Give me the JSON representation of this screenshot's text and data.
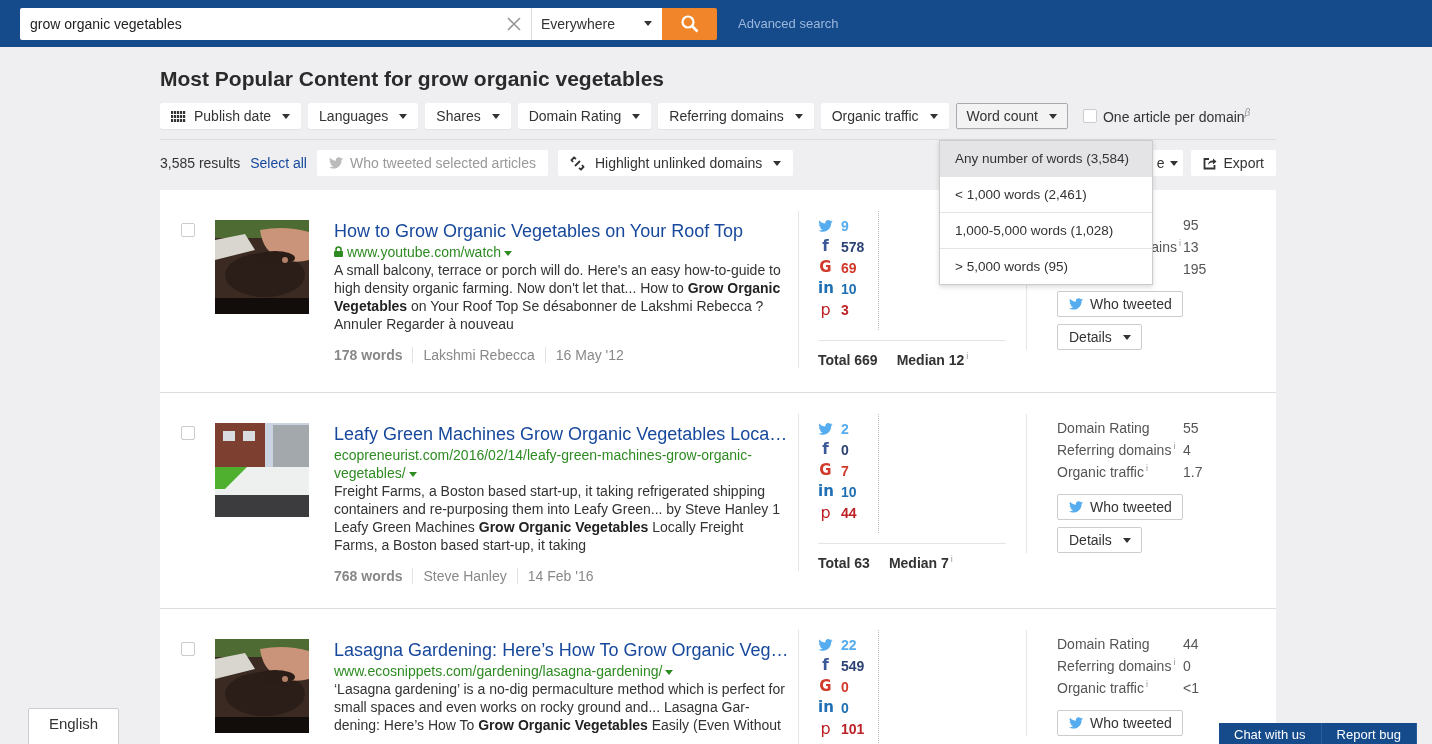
{
  "search": {
    "query": "grow organic vegetables",
    "scope": "Everywhere",
    "advanced": "Advanced search"
  },
  "heading": "Most Popular Content for grow organic vegetables",
  "filters": [
    {
      "label": "Publish date",
      "icon": true,
      "open": false
    },
    {
      "label": "Languages",
      "icon": false,
      "open": false
    },
    {
      "label": "Shares",
      "icon": false,
      "open": false
    },
    {
      "label": "Domain Rating",
      "icon": false,
      "open": false
    },
    {
      "label": "Referring domains",
      "icon": false,
      "open": false
    },
    {
      "label": "Organic traffic",
      "icon": false,
      "open": false
    },
    {
      "label": "Word count",
      "icon": false,
      "open": true
    }
  ],
  "one_per_domain": {
    "label": "One article per domain$^{β}$",
    "checked": false
  },
  "toolbar": {
    "results": "3,585 results",
    "select_all": "Select all",
    "who_tweeted": {
      "label": "Who tweeted selected articles",
      "disabled": true
    },
    "highlight": "Highlight unlinked domains",
    "sort": "e",
    "export": "Export"
  },
  "word_count_menu": [
    {
      "label": "Any number of words (3,584)",
      "selected": true
    },
    {
      "label": "< 1,000 words (2,461)",
      "selected": false
    },
    {
      "label": "1,000-5,000 words (1,028)",
      "selected": false
    },
    {
      "label": "> 5,000 words (95)",
      "selected": false
    }
  ],
  "articles": [
    {
      "checked": false,
      "title": "How to Grow Organic Vegetables on Your Roof Top",
      "secure": true,
      "url": "www.youtube.com/watch",
      "snippet": "A small balcony, terrace or porch will do. Here's an easy how-to-guide to high density organic farming. Now don't let that... How to **Grow Organic Vegetables** on Your Roof Top Se désabonner de Lakshmi Rebecca ? Annuler Regarder à nouveau",
      "words": "178 words",
      "author": "Lakshmi Rebecca",
      "date": "16 May '12",
      "shares": [
        {
          "kind": "twitter",
          "value": "9"
        },
        {
          "kind": "facebook",
          "icon": "f",
          "value": "578"
        },
        {
          "kind": "google",
          "icon": "G",
          "value": "69"
        },
        {
          "kind": "linkedin",
          "icon": "in",
          "value": "10"
        },
        {
          "kind": "pinterest",
          "icon": "p",
          "value": "3"
        }
      ],
      "total": "Total 669",
      "median": "Median 12",
      "median_info": "i",
      "metrics": [
        {
          "value": "95"
        },
        {
          "label": "ains",
          "info": "i",
          "clipped": true,
          "value": "13"
        },
        {
          "value": "195"
        }
      ],
      "buttons": [
        {
          "kind": "tweet",
          "label": "Who tweeted"
        },
        {
          "kind": "details",
          "label": "Details"
        }
      ]
    },
    {
      "checked": false,
      "title": "Leafy Green Machines Grow Organic Vegetables Loca…",
      "secure": false,
      "url": "ecopreneurist.com/2016/02/14/leafy-green-machines-grow-organic-vegetables/",
      "snippet": "Freight Farms, a Boston based start-up, it taking refrigerated shipping containers and re-purposing them into Leafy Green... by Steve Hanley 1 Leafy Green Machines **Grow Organic Vegetables** Locally Freight Farms, a Boston based start-up, it taking",
      "words": "768 words",
      "author": "Steve Hanley",
      "date": "14 Feb '16",
      "shares": [
        {
          "kind": "twitter",
          "value": "2"
        },
        {
          "kind": "facebook",
          "icon": "f",
          "value": "0"
        },
        {
          "kind": "google",
          "icon": "G",
          "value": "7"
        },
        {
          "kind": "linkedin",
          "icon": "in",
          "value": "10"
        },
        {
          "kind": "pinterest",
          "icon": "p",
          "value": "44"
        }
      ],
      "total": "Total 63",
      "median": "Median 7",
      "median_info": "i",
      "metrics": [
        {
          "label": "Domain Rating",
          "value": "55"
        },
        {
          "label": "Referring domains",
          "info": "i",
          "value": "4"
        },
        {
          "label": "Organic traffic",
          "info": "i",
          "value": "1.7"
        }
      ],
      "buttons": [
        {
          "kind": "tweet",
          "label": "Who tweeted"
        },
        {
          "kind": "details",
          "label": "Details"
        }
      ]
    },
    {
      "checked": false,
      "title": "Lasagna Gardening: Here’s How To Grow Organic Veg…",
      "secure": false,
      "url": "www.ecosnippets.com/gardening/lasagna-gardening/",
      "snippet": "‘Lasagna gardening’ is a no-dig permaculture method which is perfect for small spaces and even works on rocky ground and... Lasagna Gar-dening: Here’s How To **Grow Organic Vegetables** Easily (Even Without",
      "shares": [
        {
          "kind": "twitter",
          "value": "22"
        },
        {
          "kind": "facebook",
          "icon": "f",
          "value": "549"
        },
        {
          "kind": "google",
          "icon": "G",
          "value": "0"
        },
        {
          "kind": "linkedin",
          "icon": "in",
          "value": "0"
        },
        {
          "kind": "pinterest",
          "icon": "p",
          "value": "101"
        }
      ],
      "metrics": [
        {
          "label": "Domain Rating",
          "value": "44"
        },
        {
          "label": "Referring domains",
          "info": "i",
          "value": "0"
        },
        {
          "label": "Organic traffic",
          "info": "i",
          "value": "<1"
        }
      ],
      "buttons": [
        {
          "kind": "tweet",
          "label": "Who tweeted"
        }
      ]
    }
  ],
  "language": "English",
  "support": [
    "Chat with us",
    "Report bug"
  ]
}
